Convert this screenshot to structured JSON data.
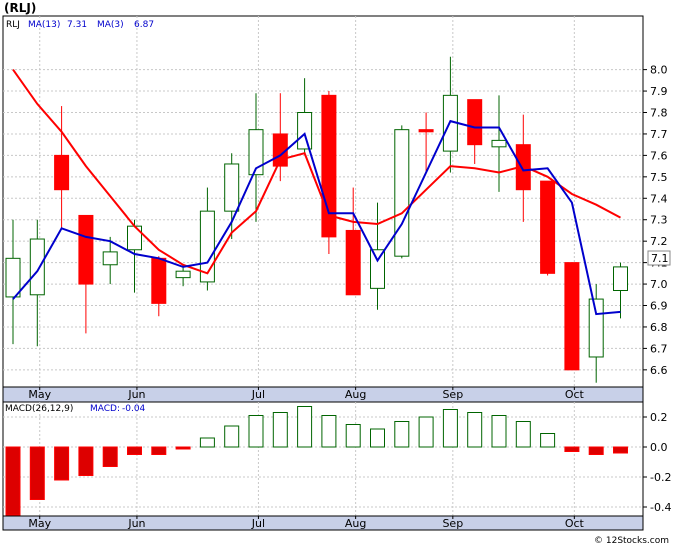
{
  "chart_data": [
    {
      "type": "candlestick",
      "title": "(RLJ)",
      "symbol_tag": "RLJ",
      "legend": [
        {
          "label": "MA(13)",
          "value": "7.31",
          "color": "#ff0000"
        },
        {
          "label": "MA(3)",
          "value": "6.87",
          "color": "#0000ff"
        }
      ],
      "last_price": "7.1",
      "watermark": "© 12Stocks.com",
      "x_labels": [
        "May",
        "Jun",
        "Jul",
        "Aug",
        "Sep",
        "Oct"
      ],
      "y_ticks": [
        "8.0",
        "7.9",
        "7.8",
        "7.7",
        "7.6",
        "7.5",
        "7.4",
        "7.3",
        "7.2",
        "7.1",
        "7.0",
        "6.9",
        "6.8",
        "6.7",
        "6.6"
      ],
      "ylim": [
        6.52,
        8.25
      ],
      "grid": true,
      "candles": [
        {
          "o": 6.94,
          "h": 7.3,
          "l": 6.72,
          "c": 7.12
        },
        {
          "o": 6.95,
          "h": 7.3,
          "l": 6.71,
          "c": 7.21
        },
        {
          "o": 7.6,
          "h": 7.83,
          "l": 7.26,
          "c": 7.44
        },
        {
          "o": 7.32,
          "h": 7.32,
          "l": 6.77,
          "c": 7.0
        },
        {
          "o": 7.09,
          "h": 7.22,
          "l": 7.0,
          "c": 7.15
        },
        {
          "o": 7.16,
          "h": 7.3,
          "l": 6.96,
          "c": 7.27
        },
        {
          "o": 7.12,
          "h": 7.13,
          "l": 6.85,
          "c": 6.91
        },
        {
          "o": 7.03,
          "h": 7.09,
          "l": 6.99,
          "c": 7.06
        },
        {
          "o": 7.01,
          "h": 7.45,
          "l": 6.97,
          "c": 7.34
        },
        {
          "o": 7.34,
          "h": 7.61,
          "l": 7.21,
          "c": 7.56
        },
        {
          "o": 7.51,
          "h": 7.89,
          "l": 7.29,
          "c": 7.72
        },
        {
          "o": 7.7,
          "h": 7.89,
          "l": 7.48,
          "c": 7.55
        },
        {
          "o": 7.63,
          "h": 7.96,
          "l": 7.61,
          "c": 7.8
        },
        {
          "o": 7.88,
          "h": 7.9,
          "l": 7.14,
          "c": 7.22
        },
        {
          "o": 7.25,
          "h": 7.45,
          "l": 6.95,
          "c": 6.95
        },
        {
          "o": 6.98,
          "h": 7.38,
          "l": 6.88,
          "c": 7.16
        },
        {
          "o": 7.13,
          "h": 7.74,
          "l": 7.12,
          "c": 7.72
        },
        {
          "o": 7.72,
          "h": 7.8,
          "l": 7.52,
          "c": 7.71
        },
        {
          "o": 7.62,
          "h": 8.06,
          "l": 7.52,
          "c": 7.88
        },
        {
          "o": 7.86,
          "h": 7.86,
          "l": 7.56,
          "c": 7.65
        },
        {
          "o": 7.64,
          "h": 7.88,
          "l": 7.43,
          "c": 7.67
        },
        {
          "o": 7.65,
          "h": 7.79,
          "l": 7.29,
          "c": 7.44
        },
        {
          "o": 7.48,
          "h": 7.48,
          "l": 7.04,
          "c": 7.05
        },
        {
          "o": 7.1,
          "h": 7.1,
          "l": 6.6,
          "c": 6.6
        },
        {
          "o": 6.66,
          "h": 7.0,
          "l": 6.54,
          "c": 6.93
        },
        {
          "o": 6.97,
          "h": 7.1,
          "l": 6.84,
          "c": 7.08
        }
      ],
      "ma13": [
        8.0,
        7.84,
        7.71,
        7.55,
        7.41,
        7.27,
        7.16,
        7.09,
        7.05,
        7.24,
        7.34,
        7.58,
        7.61,
        7.32,
        7.29,
        7.28,
        7.33,
        7.44,
        7.55,
        7.54,
        7.52,
        7.55,
        7.5,
        7.42,
        7.37,
        7.31
      ],
      "ma3": [
        6.93,
        7.06,
        7.26,
        7.22,
        7.2,
        7.14,
        7.12,
        7.08,
        7.1,
        7.29,
        7.54,
        7.6,
        7.7,
        7.33,
        7.33,
        7.11,
        7.28,
        7.52,
        7.76,
        7.73,
        7.73,
        7.53,
        7.54,
        7.38,
        6.86,
        6.87
      ]
    },
    {
      "type": "bar",
      "title": "MACD(26,12,9)",
      "legend": [
        {
          "label": "MACD:",
          "value": "-0.04",
          "color": "#0000ff"
        }
      ],
      "x_labels": [
        "May",
        "Jun",
        "Jul",
        "Aug",
        "Sep",
        "Oct"
      ],
      "y_ticks": [
        "0.2",
        "0.0",
        "-0.2",
        "-0.4"
      ],
      "ylim": [
        -0.46,
        0.3
      ],
      "values": [
        -0.49,
        -0.35,
        -0.22,
        -0.19,
        -0.13,
        -0.05,
        -0.05,
        -0.01,
        0.06,
        0.14,
        0.21,
        0.23,
        0.27,
        0.21,
        0.15,
        0.12,
        0.17,
        0.2,
        0.25,
        0.23,
        0.21,
        0.17,
        0.09,
        -0.03,
        -0.05,
        -0.04
      ]
    }
  ],
  "colors": {
    "up": "#006400",
    "down": "#ff0000",
    "ma13": "#ff0000",
    "ma3": "#0000cc",
    "axis_band": "#c8d0e8",
    "grid": "#c8c8c8"
  }
}
